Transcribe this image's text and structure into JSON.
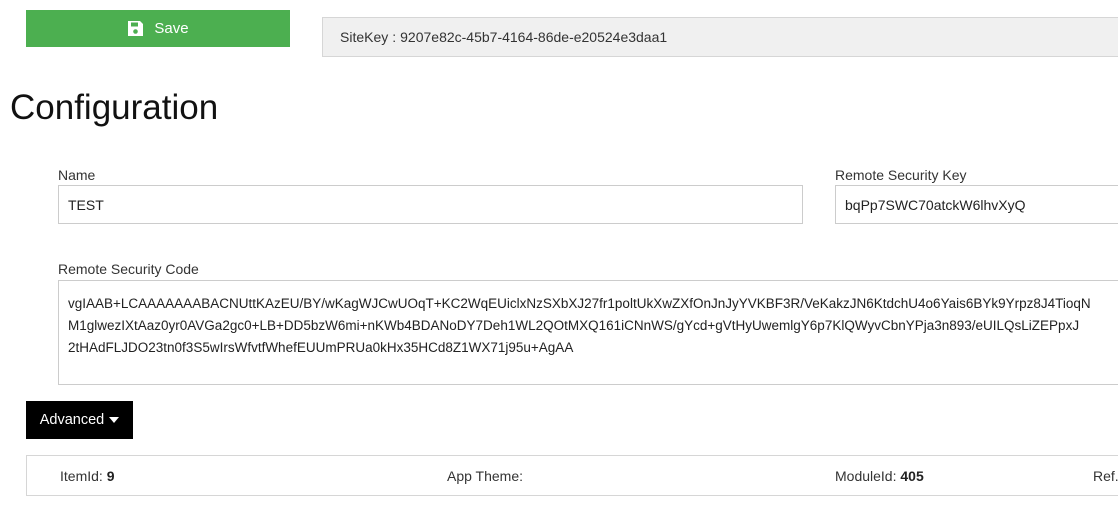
{
  "toolbar": {
    "save_label": "Save",
    "save_icon": "floppy-disk-icon",
    "save_color": "#4caf50"
  },
  "sitekey": {
    "label": "SiteKey",
    "separator": ":",
    "value": "9207e82c-45b7-4164-86de-e20524e3daa1"
  },
  "page": {
    "title": "Configuration"
  },
  "form": {
    "name": {
      "label": "Name",
      "value": "TEST"
    },
    "remote_security_key": {
      "label": "Remote Security Key",
      "value": "bqPp7SWC70atckW6lhvXyQ"
    },
    "remote_security_code": {
      "label": "Remote Security Code",
      "lines": [
        "vgIAAB+LCAAAAAAABACNUttKAzEU/BY/wKagWJCwUOqT+KC2WqEUiclxNzSXbXJ27fr1poltUkXwZXfOnJnJyYVKBF3R/VeKakzJN6KtdchU4o6Yais6BYk9Yrpz8J4TioqN",
        "M1glwezIXtAaz0yr0AVGa2gc0+LB+DD5bzW6mi+nKWb4BDANoDY7Deh1WL2QOtMXQ161iCNnWS/gYcd+gVtHyUwemlgY6p7KlQWyvCbnYPja3n893/eUILQsLiZEPpxJ",
        "2tHAdFLJDO23tn0f3S5wIrsWfvtfWhefEUUmPRUa0kHx35HCd8Z1WX71j95u+AgAA"
      ]
    }
  },
  "advanced": {
    "label": "Advanced"
  },
  "info": {
    "itemid_label": "ItemId:",
    "itemid_value": "9",
    "app_theme_label": "App Theme:",
    "app_theme_value": "",
    "moduleid_label": "ModuleId:",
    "moduleid_value": "405",
    "ref_label": "Ref."
  }
}
